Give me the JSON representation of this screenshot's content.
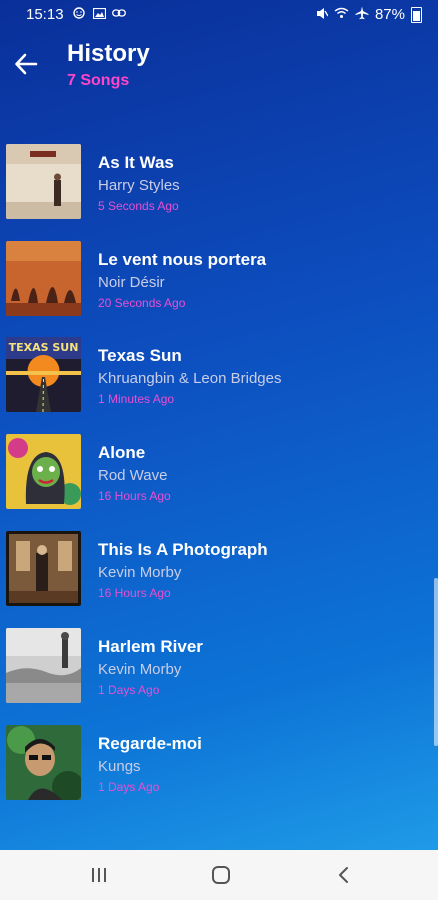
{
  "status_bar": {
    "time": "15:13",
    "battery": "87%",
    "left_icons": [
      "smile-icon",
      "image-icon",
      "link-icon"
    ],
    "right_icons": [
      "mute-icon",
      "wifi-icon",
      "airplane-icon",
      "battery-icon"
    ]
  },
  "header": {
    "title": "History",
    "subtitle": "7 Songs",
    "back_icon": "arrow-left-icon"
  },
  "songs": [
    {
      "title": "As It Was",
      "artist": "Harry Styles",
      "time": "5 Seconds Ago"
    },
    {
      "title": "Le vent nous portera",
      "artist": "Noir Désir",
      "time": "20 Seconds Ago"
    },
    {
      "title": "Texas Sun",
      "artist": "Khruangbin & Leon Bridges",
      "time": "1 Minutes Ago",
      "art_text": "TEXAS SUN"
    },
    {
      "title": "Alone",
      "artist": "Rod Wave",
      "time": "16 Hours Ago"
    },
    {
      "title": "This Is A Photograph",
      "artist": "Kevin Morby",
      "time": "16 Hours Ago"
    },
    {
      "title": "Harlem River",
      "artist": "Kevin Morby",
      "time": "1 Days Ago"
    },
    {
      "title": "Regarde-moi",
      "artist": "Kungs",
      "time": "1 Days Ago"
    }
  ],
  "colors": {
    "subtitle": "#ff45c9",
    "time_text": "#e94fd2",
    "artist_text": "#c9cde6",
    "nav_bar": "#f6f6f6"
  },
  "nav_bar": {
    "buttons": [
      "recents-icon",
      "home-icon",
      "back-icon"
    ]
  }
}
